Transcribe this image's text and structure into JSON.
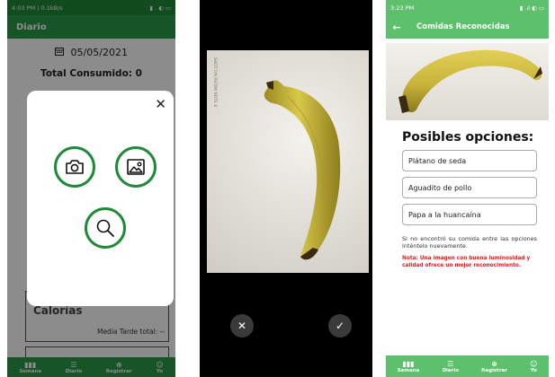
{
  "panel1": {
    "status": {
      "time": "4:03 PM | 0.1kB/s",
      "right": "▮ . ◐ ▭"
    },
    "appbar_title": "Diario",
    "date": "05/05/2021",
    "total_label": "Total Consumido: 0",
    "calories_card": {
      "title": "Calorías",
      "subtitle": "Media Tarde total: --"
    },
    "nav": [
      "Semana",
      "Diario",
      "Registrar",
      "Yo"
    ],
    "modal": {
      "close": "✕"
    }
  },
  "panel2": {
    "watermark": "SHOT ON REDMI NOTE 8",
    "cancel": "✕",
    "confirm": "✓"
  },
  "panel3": {
    "status": {
      "time": "3:23 PM",
      "right": "▮ .ıl ◐ ▭"
    },
    "title": "Comidas Reconocidas",
    "heading": "Posibles opciones:",
    "options": [
      "Plátano de seda",
      "Aguadito de pollo",
      "Papa a la huancaína"
    ],
    "info": "Si no encontró su comida entre las opciones inténtelo nuevamente.",
    "note": "Nota: Una imagen con buena luminosidad y calidad ofrece un mejor reconocimiento.",
    "nav": [
      "Semana",
      "Diario",
      "Registrar",
      "Yo"
    ]
  },
  "colors": {
    "green_dark": "#1f8a3a",
    "green": "#2a9a47",
    "green_light": "#5cc06c",
    "note_red": "#e02020"
  }
}
